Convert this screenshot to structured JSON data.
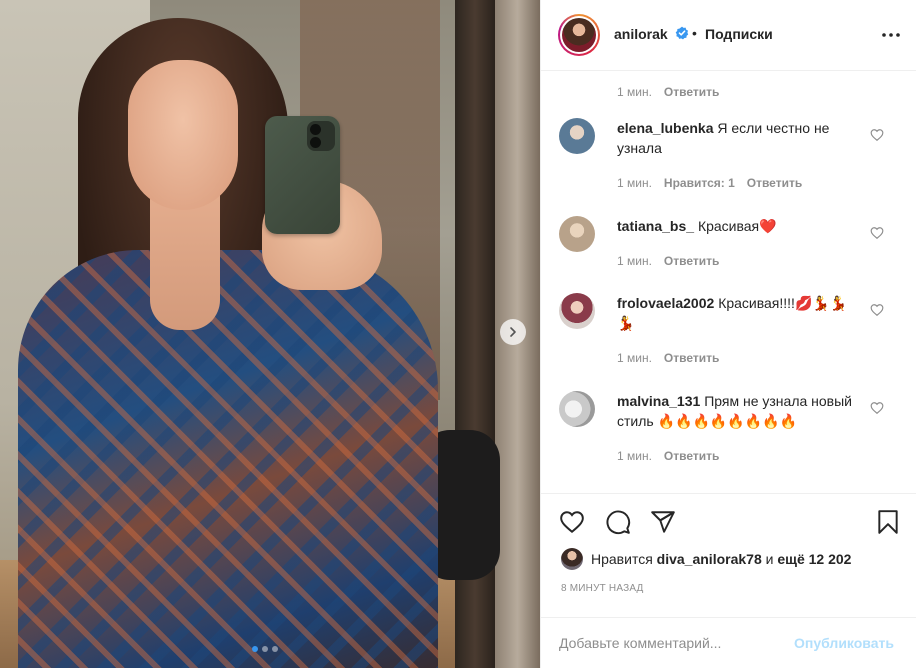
{
  "post": {
    "username": "anilorak",
    "verified": true,
    "separator": "•",
    "follow_label": "Подписки",
    "more_icon": "more-options-icon",
    "carousel_dots": 3,
    "active_dot": 0
  },
  "comments": [
    {
      "time": "1 мин.",
      "reply": "Ответить"
    },
    {
      "user": "elena_lubenka",
      "text": "Я если честно не узнала",
      "time": "1 мин.",
      "likes": "Нравится: 1",
      "reply": "Ответить",
      "avatar_color": "#5a7a96"
    },
    {
      "user": "tatiana_bs_",
      "text": "Красивая❤️",
      "time": "1 мин.",
      "reply": "Ответить",
      "avatar_color": "#b8a28a"
    },
    {
      "user": "frolovaela2002",
      "text": "Красивая!!!!💋💃💃💃",
      "time": "1 мин.",
      "reply": "Ответить",
      "avatar_color": "#8a3b4a"
    },
    {
      "user": "malvina_131",
      "text": "Прям не узнала новый стиль 🔥🔥🔥🔥🔥🔥🔥🔥",
      "time": "1 мин.",
      "reply": "Ответить",
      "avatar_color": "#c9c9c9"
    }
  ],
  "likes": {
    "prefix": "Нравится",
    "user": "diva_anilorak78",
    "and": "и",
    "more": "ещё 12 202"
  },
  "time_ago": "8 МИНУТ НАЗАД",
  "add_comment": {
    "placeholder": "Добавьте комментарий...",
    "post_label": "Опубликовать"
  },
  "colors": {
    "accent": "#3897f0",
    "post_disabled": "#b2dffc",
    "meta": "#8e8e8e",
    "text": "#262626"
  }
}
